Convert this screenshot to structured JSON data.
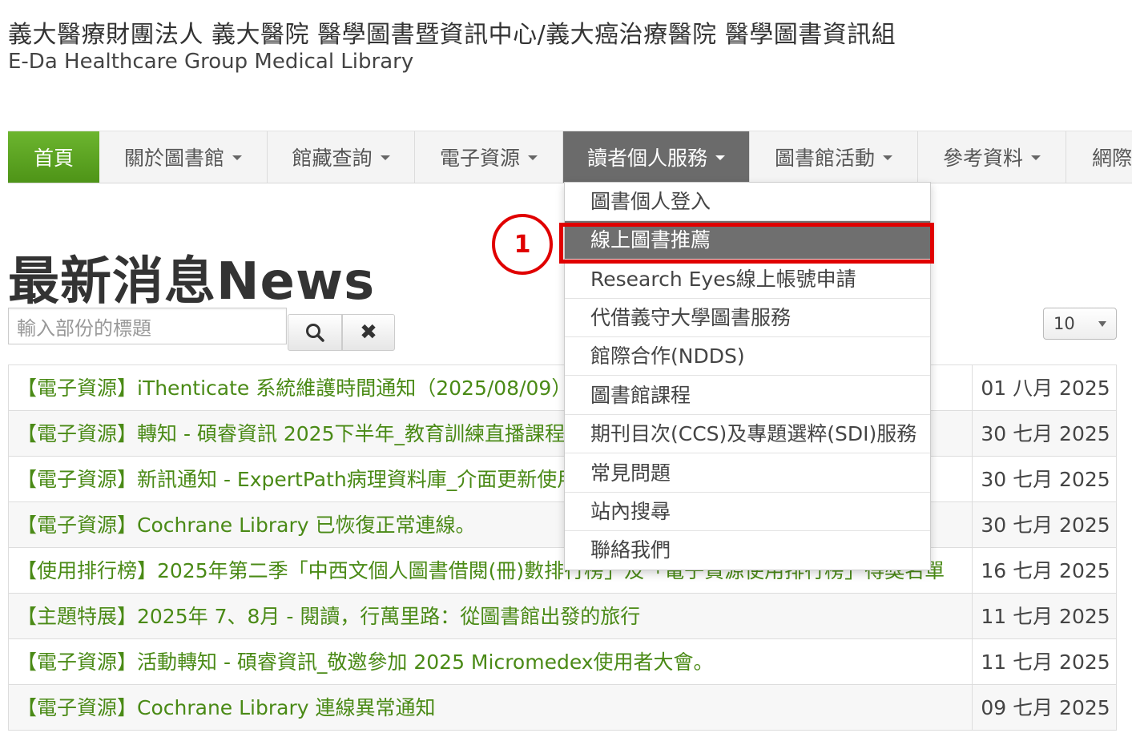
{
  "header": {
    "title": "義大醫療財團法人 義大醫院 醫學圖書暨資訊中心/義大癌治療醫院 醫學圖書資訊組",
    "subtitle": "E-Da Healthcare Group Medical Library"
  },
  "nav": {
    "items": [
      {
        "label": "首頁"
      },
      {
        "label": "關於圖書館"
      },
      {
        "label": "館藏查詢"
      },
      {
        "label": "電子資源"
      },
      {
        "label": "讀者個人服務"
      },
      {
        "label": "圖書館活動"
      },
      {
        "label": "參考資料"
      },
      {
        "label": "網際"
      }
    ],
    "active_index": 4
  },
  "dropdown": {
    "items": [
      {
        "label": "圖書個人登入"
      },
      {
        "label": "線上圖書推薦"
      },
      {
        "label": "Research Eyes線上帳號申請"
      },
      {
        "label": "代借義守大學圖書服務"
      },
      {
        "label": "館際合作(NDDS)"
      },
      {
        "label": "圖書館課程"
      },
      {
        "label": "期刊目次(CCS)及專題選粹(SDI)服務"
      },
      {
        "label": "常見問題"
      },
      {
        "label": "站內搜尋"
      },
      {
        "label": "聯絡我們"
      }
    ],
    "highlighted_index": 1
  },
  "annotation": {
    "step_number": "1",
    "color": "#e00000"
  },
  "news": {
    "title": "最新消息News",
    "search_placeholder": "輸入部份的標題",
    "clear_symbol": "✖",
    "page_size": "10",
    "rows": [
      {
        "title": "【電子資源】iThenticate 系統維護時間通知（2025/08/09）",
        "date": "01 八月 2025"
      },
      {
        "title": "【電子資源】轉知 - 碩睿資訊 2025下半年_教育訓練直播課程",
        "date": "30 七月 2025"
      },
      {
        "title": "【電子資源】新訊通知 - ExpertPath病理資料庫_介面更新使用",
        "date": "30 七月 2025"
      },
      {
        "title": "【電子資源】Cochrane Library 已恢復正常連線。",
        "date": "30 七月 2025"
      },
      {
        "title": "【使用排行榜】2025年第二季「中西文個人圖書借閱(冊)數排行榜」及「電子資源使用排行榜」得獎名單",
        "date": "16 七月 2025"
      },
      {
        "title": "【主題特展】2025年 7、8月 - 閱讀，行萬里路：從圖書館出發的旅行",
        "date": "11 七月 2025"
      },
      {
        "title": "【電子資源】活動轉知 - 碩睿資訊_敬邀參加 2025 Micromedex使用者大會。",
        "date": "11 七月 2025"
      },
      {
        "title": "【電子資源】Cochrane Library 連線異常通知",
        "date": "09 七月 2025"
      }
    ]
  },
  "colors": {
    "accent_green": "#5aa41f",
    "link_green": "#4a8a16",
    "active_nav": "#6b6b6b"
  }
}
